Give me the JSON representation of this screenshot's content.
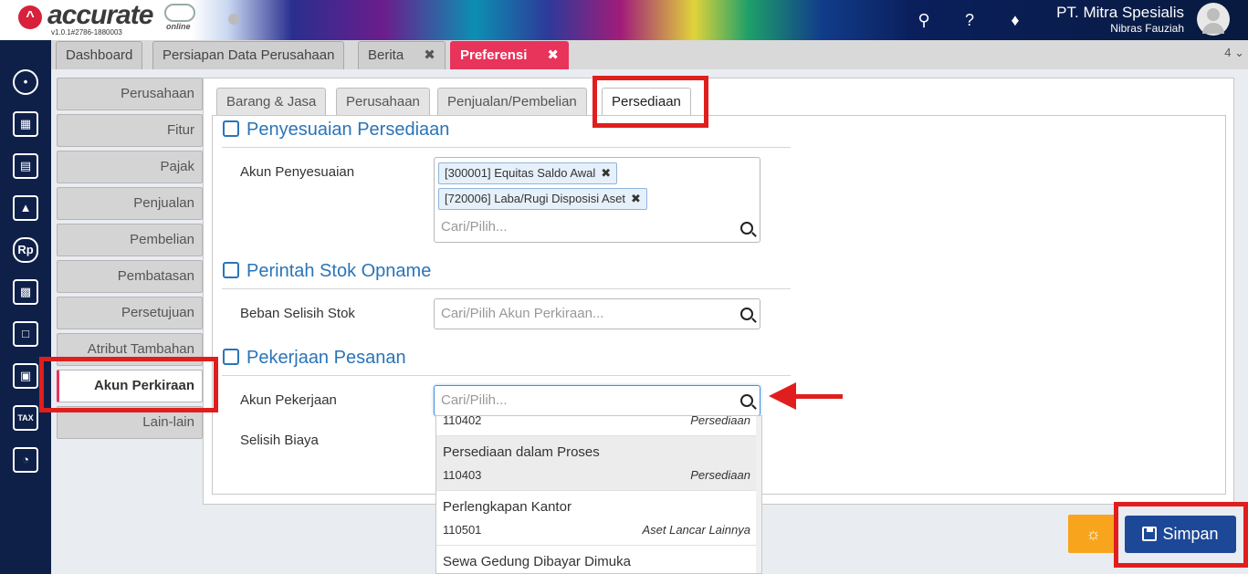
{
  "app": {
    "logo_text": "accurate",
    "logo_suffix": "online",
    "version": "v1.0.1#2786-1880003",
    "company_name": "PT. Mitra Spesialis",
    "user_name": "Nibras Fauziah"
  },
  "tabs": [
    {
      "label": "Dashboard"
    },
    {
      "label": "Persiapan Data Perusahaan"
    },
    {
      "label": "Berita"
    },
    {
      "label": "Preferensi"
    }
  ],
  "tab_count": "4",
  "left_nav": [
    "Perusahaan",
    "Fitur",
    "Pajak",
    "Penjualan",
    "Pembelian",
    "Pembatasan",
    "Persetujuan",
    "Atribut Tambahan",
    "Akun Perkiraan",
    "Lain-lain"
  ],
  "sub_tabs": [
    "Barang & Jasa",
    "Perusahaan",
    "Penjualan/Pembelian",
    "Persediaan"
  ],
  "sections": {
    "penyesuaian": {
      "title": "Penyesuaian Persediaan",
      "label": "Akun Penyesuaian",
      "chips": [
        "[300001] Equitas Saldo Awal",
        "[720006] Laba/Rugi Disposisi Aset"
      ],
      "placeholder": "Cari/Pilih..."
    },
    "opname": {
      "title": "Perintah Stok Opname",
      "label": "Beban Selisih Stok",
      "placeholder": "Cari/Pilih Akun Perkiraan..."
    },
    "pekerjaan": {
      "title": "Pekerjaan Pesanan",
      "label": "Akun Pekerjaan",
      "placeholder": "Cari/Pilih...",
      "label2": "Selisih Biaya"
    }
  },
  "dropdown": [
    {
      "name": "",
      "code": "110402",
      "type": "Persediaan"
    },
    {
      "name": "Persediaan dalam Proses",
      "code": "110403",
      "type": "Persediaan"
    },
    {
      "name": "Perlengkapan Kantor",
      "code": "110501",
      "type": "Aset Lancar Lainnya"
    },
    {
      "name": "Sewa Gedung Dibayar Dimuka",
      "code": "",
      "type": ""
    }
  ],
  "buttons": {
    "save": "Simpan"
  },
  "colors": {
    "accent_tab": "#e8335a",
    "section_title": "#2a74b8",
    "save_button": "#1d4797",
    "hint_button": "#f8a51d",
    "highlight": "#e01e1e",
    "sidebar": "#0f2048"
  }
}
